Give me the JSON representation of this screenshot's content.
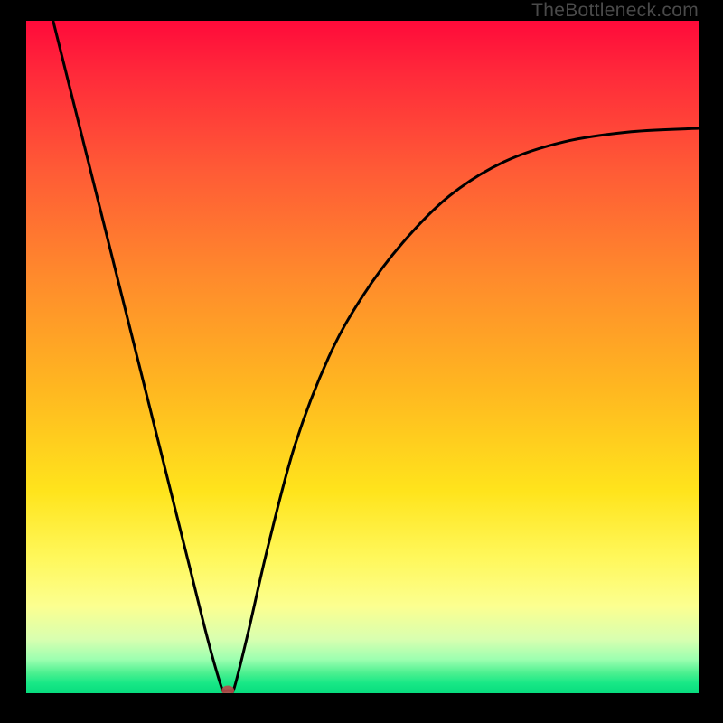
{
  "watermark": {
    "text": "TheBottleneck.com"
  },
  "chart_data": {
    "type": "line",
    "title": "",
    "xlabel": "",
    "ylabel": "",
    "xlim": [
      0,
      1
    ],
    "ylim": [
      0,
      1
    ],
    "background": {
      "style": "vertical-gradient",
      "stops": [
        {
          "pos": 0.0,
          "color": "#ff0a3a"
        },
        {
          "pos": 0.22,
          "color": "#ff5a36"
        },
        {
          "pos": 0.55,
          "color": "#ffb820"
        },
        {
          "pos": 0.8,
          "color": "#fff85c"
        },
        {
          "pos": 0.95,
          "color": "#9cffb0"
        },
        {
          "pos": 1.0,
          "color": "#08dc7e"
        }
      ]
    },
    "series": [
      {
        "name": "bottleneck-curve",
        "color": "#000000",
        "x": [
          0.04,
          0.08,
          0.12,
          0.16,
          0.2,
          0.24,
          0.27,
          0.29,
          0.295,
          0.3,
          0.305,
          0.31,
          0.33,
          0.36,
          0.4,
          0.45,
          0.5,
          0.56,
          0.63,
          0.71,
          0.8,
          0.9,
          1.0
        ],
        "y": [
          1.0,
          0.84,
          0.68,
          0.52,
          0.36,
          0.2,
          0.08,
          0.01,
          0.004,
          0.004,
          0.004,
          0.01,
          0.09,
          0.22,
          0.37,
          0.5,
          0.59,
          0.67,
          0.74,
          0.79,
          0.82,
          0.835,
          0.84
        ]
      }
    ],
    "marker": {
      "name": "minimum-point",
      "x": 0.3,
      "y": 0.004,
      "color": "#b84a4a"
    }
  }
}
